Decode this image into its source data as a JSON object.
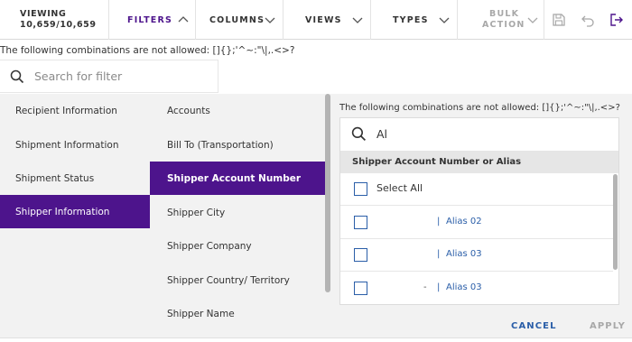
{
  "toolbar": {
    "viewing_label": "VIEWING",
    "viewing_count": "10,659/10,659",
    "filters_label": "FILTERS",
    "columns_label": "COLUMNS",
    "views_label": "VIEWS",
    "types_label": "TYPES",
    "bulk_action_line1": "BULK",
    "bulk_action_line2": "ACTION",
    "icons": [
      "save-icon",
      "undo-icon",
      "exit-icon"
    ],
    "accent_color": "#4d148c"
  },
  "filter": {
    "warning": "The following combinations are not allowed: []{};'^~:\"\\|,.<>?",
    "search_placeholder": "Search for filter"
  },
  "categories": [
    {
      "label": "Recipient Information"
    },
    {
      "label": "Shipment Information"
    },
    {
      "label": "Shipment Status"
    },
    {
      "label": "Shipper Information",
      "active": true
    }
  ],
  "fields": [
    {
      "label": "Accounts"
    },
    {
      "label": "Bill To (Transportation)"
    },
    {
      "label": "Shipper Account Number",
      "active": true
    },
    {
      "label": "Shipper City"
    },
    {
      "label": "Shipper Company"
    },
    {
      "label": "Shipper Country/ Territory"
    },
    {
      "label": "Shipper Name"
    }
  ],
  "values_panel": {
    "warning": "The following combinations are not allowed: []{};'^~:\"\\|,.<>?",
    "search_value": "Al",
    "header": "Shipper Account Number or Alias",
    "select_all_label": "Select All",
    "rows": [
      {
        "prefix": "",
        "separator": "|",
        "alias": "Alias 02"
      },
      {
        "prefix": "",
        "separator": "|",
        "alias": "Alias 03"
      },
      {
        "prefix": "-",
        "separator": "|",
        "alias": "Alias 03"
      }
    ],
    "cancel_label": "CANCEL",
    "apply_label": "APPLY",
    "link_color": "#2a5ea8"
  }
}
